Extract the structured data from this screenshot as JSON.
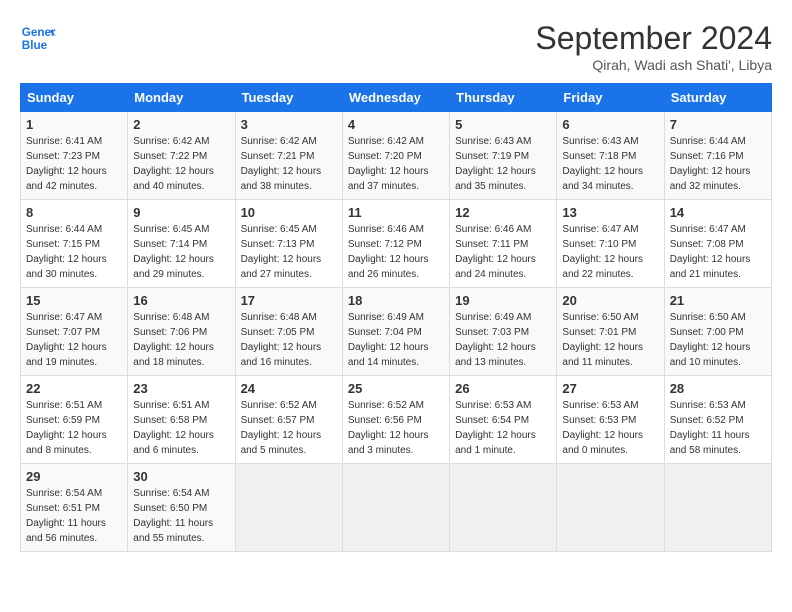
{
  "header": {
    "logo_line1": "General",
    "logo_line2": "Blue",
    "month": "September 2024",
    "location": "Qirah, Wadi ash Shati', Libya"
  },
  "days_of_week": [
    "Sunday",
    "Monday",
    "Tuesday",
    "Wednesday",
    "Thursday",
    "Friday",
    "Saturday"
  ],
  "weeks": [
    [
      {
        "day": "1",
        "sunrise": "6:41 AM",
        "sunset": "7:23 PM",
        "daylight": "12 hours and 42 minutes."
      },
      {
        "day": "2",
        "sunrise": "6:42 AM",
        "sunset": "7:22 PM",
        "daylight": "12 hours and 40 minutes."
      },
      {
        "day": "3",
        "sunrise": "6:42 AM",
        "sunset": "7:21 PM",
        "daylight": "12 hours and 38 minutes."
      },
      {
        "day": "4",
        "sunrise": "6:42 AM",
        "sunset": "7:20 PM",
        "daylight": "12 hours and 37 minutes."
      },
      {
        "day": "5",
        "sunrise": "6:43 AM",
        "sunset": "7:19 PM",
        "daylight": "12 hours and 35 minutes."
      },
      {
        "day": "6",
        "sunrise": "6:43 AM",
        "sunset": "7:18 PM",
        "daylight": "12 hours and 34 minutes."
      },
      {
        "day": "7",
        "sunrise": "6:44 AM",
        "sunset": "7:16 PM",
        "daylight": "12 hours and 32 minutes."
      }
    ],
    [
      {
        "day": "8",
        "sunrise": "6:44 AM",
        "sunset": "7:15 PM",
        "daylight": "12 hours and 30 minutes."
      },
      {
        "day": "9",
        "sunrise": "6:45 AM",
        "sunset": "7:14 PM",
        "daylight": "12 hours and 29 minutes."
      },
      {
        "day": "10",
        "sunrise": "6:45 AM",
        "sunset": "7:13 PM",
        "daylight": "12 hours and 27 minutes."
      },
      {
        "day": "11",
        "sunrise": "6:46 AM",
        "sunset": "7:12 PM",
        "daylight": "12 hours and 26 minutes."
      },
      {
        "day": "12",
        "sunrise": "6:46 AM",
        "sunset": "7:11 PM",
        "daylight": "12 hours and 24 minutes."
      },
      {
        "day": "13",
        "sunrise": "6:47 AM",
        "sunset": "7:10 PM",
        "daylight": "12 hours and 22 minutes."
      },
      {
        "day": "14",
        "sunrise": "6:47 AM",
        "sunset": "7:08 PM",
        "daylight": "12 hours and 21 minutes."
      }
    ],
    [
      {
        "day": "15",
        "sunrise": "6:47 AM",
        "sunset": "7:07 PM",
        "daylight": "12 hours and 19 minutes."
      },
      {
        "day": "16",
        "sunrise": "6:48 AM",
        "sunset": "7:06 PM",
        "daylight": "12 hours and 18 minutes."
      },
      {
        "day": "17",
        "sunrise": "6:48 AM",
        "sunset": "7:05 PM",
        "daylight": "12 hours and 16 minutes."
      },
      {
        "day": "18",
        "sunrise": "6:49 AM",
        "sunset": "7:04 PM",
        "daylight": "12 hours and 14 minutes."
      },
      {
        "day": "19",
        "sunrise": "6:49 AM",
        "sunset": "7:03 PM",
        "daylight": "12 hours and 13 minutes."
      },
      {
        "day": "20",
        "sunrise": "6:50 AM",
        "sunset": "7:01 PM",
        "daylight": "12 hours and 11 minutes."
      },
      {
        "day": "21",
        "sunrise": "6:50 AM",
        "sunset": "7:00 PM",
        "daylight": "12 hours and 10 minutes."
      }
    ],
    [
      {
        "day": "22",
        "sunrise": "6:51 AM",
        "sunset": "6:59 PM",
        "daylight": "12 hours and 8 minutes."
      },
      {
        "day": "23",
        "sunrise": "6:51 AM",
        "sunset": "6:58 PM",
        "daylight": "12 hours and 6 minutes."
      },
      {
        "day": "24",
        "sunrise": "6:52 AM",
        "sunset": "6:57 PM",
        "daylight": "12 hours and 5 minutes."
      },
      {
        "day": "25",
        "sunrise": "6:52 AM",
        "sunset": "6:56 PM",
        "daylight": "12 hours and 3 minutes."
      },
      {
        "day": "26",
        "sunrise": "6:53 AM",
        "sunset": "6:54 PM",
        "daylight": "12 hours and 1 minute."
      },
      {
        "day": "27",
        "sunrise": "6:53 AM",
        "sunset": "6:53 PM",
        "daylight": "12 hours and 0 minutes."
      },
      {
        "day": "28",
        "sunrise": "6:53 AM",
        "sunset": "6:52 PM",
        "daylight": "11 hours and 58 minutes."
      }
    ],
    [
      {
        "day": "29",
        "sunrise": "6:54 AM",
        "sunset": "6:51 PM",
        "daylight": "11 hours and 56 minutes."
      },
      {
        "day": "30",
        "sunrise": "6:54 AM",
        "sunset": "6:50 PM",
        "daylight": "11 hours and 55 minutes."
      },
      null,
      null,
      null,
      null,
      null
    ]
  ]
}
